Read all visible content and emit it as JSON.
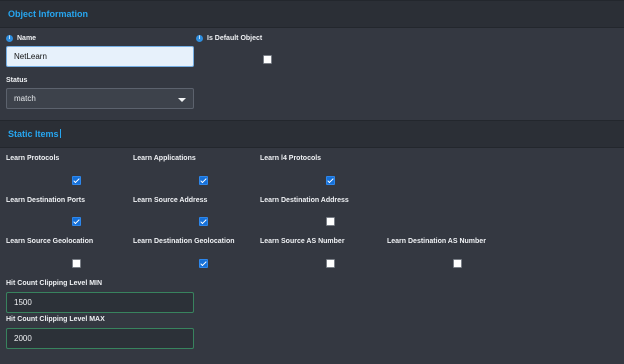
{
  "object_information": {
    "title": "Object Information",
    "name_label": "Name",
    "name_value": "NetLearn",
    "default_object_label": "Is Default Object",
    "default_object_checked": false,
    "status_label": "Status",
    "status_value": "match"
  },
  "static_items": {
    "title": "Static Items",
    "checkboxes": [
      {
        "label": "Learn Protocols",
        "checked": true
      },
      {
        "label": "Learn Applications",
        "checked": true
      },
      {
        "label": "Learn l4 Protocols",
        "checked": true
      },
      {
        "label": "Learn Destination Ports",
        "checked": true
      },
      {
        "label": "Learn Source Address",
        "checked": true
      },
      {
        "label": "Learn Destination Address",
        "checked": false
      },
      {
        "label": "Learn Source Geolocation",
        "checked": false
      },
      {
        "label": "Learn Destination Geolocation",
        "checked": true
      },
      {
        "label": "Learn Source AS Number",
        "checked": false
      },
      {
        "label": "Learn Destination AS Number",
        "checked": false
      }
    ],
    "hit_count_min_label": "Hit Count Clipping Level MIN",
    "hit_count_min_value": "1500",
    "hit_count_max_label": "Hit Count Clipping Level MAX",
    "hit_count_max_value": "2000"
  },
  "icons": {
    "info": "i",
    "dropdown": "chevron-down-icon",
    "checkbox_checked": "checkmark-icon"
  },
  "colors": {
    "background": "#2a2e35",
    "section_body": "#343841",
    "header_text": "#27a6f0",
    "checkbox_checked": "#1570d8",
    "input_focus_border": "#75aee3",
    "input_valid_border": "#38835e"
  }
}
